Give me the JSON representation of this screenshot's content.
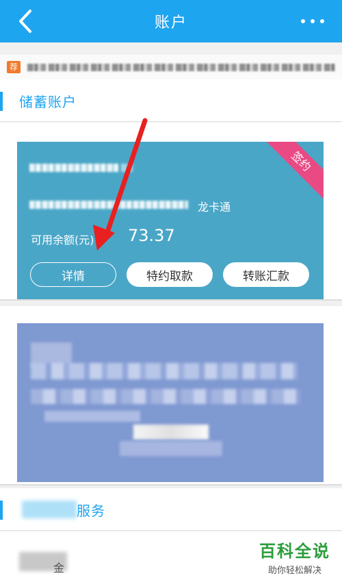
{
  "header": {
    "title": "账户",
    "back_icon": "chevron-left-icon",
    "more_icon": "more-horizontal-icon"
  },
  "notice": {
    "tag": "荐"
  },
  "sections": {
    "savings": {
      "title": "储蓄账户"
    },
    "services": {
      "title": "服务"
    }
  },
  "card": {
    "ribbon": "签约",
    "type": "龙卡通",
    "balance_label": "可用余额(元)",
    "balance": "73.37",
    "buttons": {
      "details": "详情",
      "special_withdraw": "特约取款",
      "transfer": "转账汇款"
    }
  },
  "footer_row": {
    "partial_label": "金"
  },
  "watermark": {
    "logo": "百科全说",
    "sub": "助你轻松解决"
  },
  "colors": {
    "brand_blue": "#1ea5f0",
    "card_blue": "#4aa6c7",
    "card_purple": "#7f99d1",
    "ribbon_pink": "#e94a84",
    "arrow_red": "#e82020"
  }
}
